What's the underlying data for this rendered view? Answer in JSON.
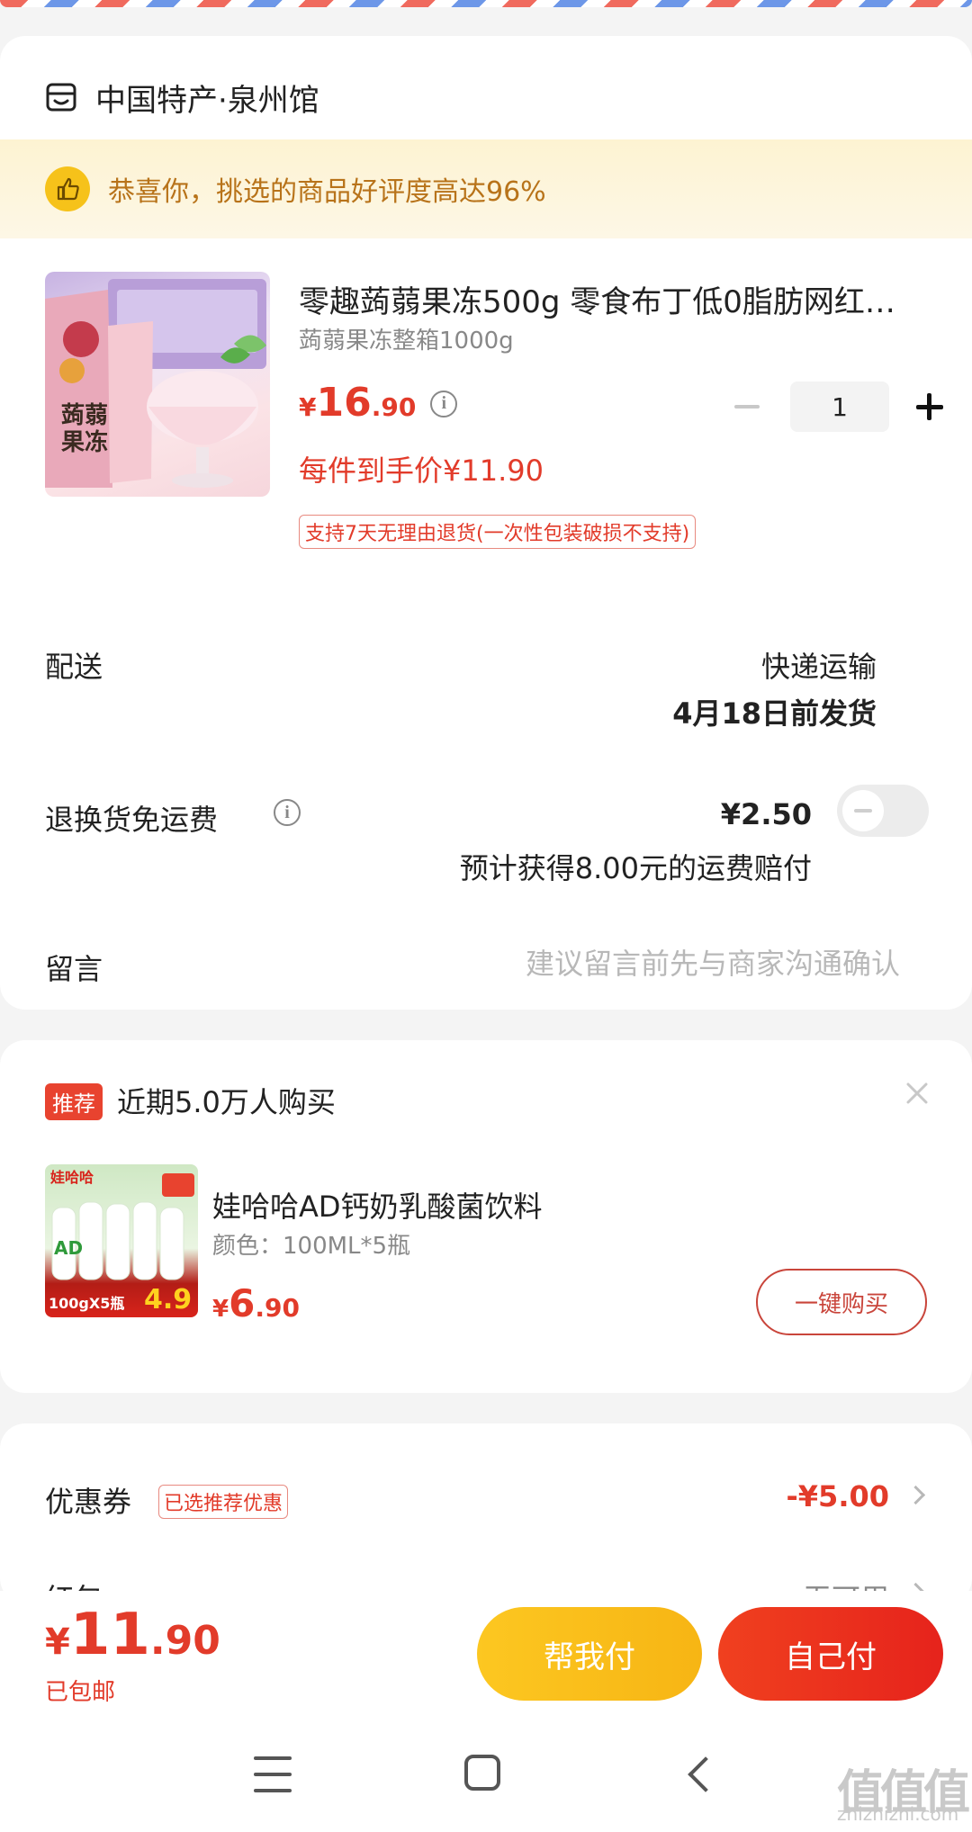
{
  "shop": {
    "name": "中国特产·泉州馆",
    "praise": "恭喜你，挑选的商品好评度高达96%"
  },
  "product": {
    "title": "零趣蒟蒻果冻500g 零食布丁低0脂肪网红…",
    "sku": "蒟蒻果冻整箱1000g",
    "price_symbol": "¥",
    "price_int": "16",
    "price_dec": ".90",
    "net_price": "每件到手价¥11.90",
    "return_policy": "支持7天无理由退货(一次性包装破损不支持)",
    "quantity": "1",
    "image_text_1": "蒟蒻",
    "image_text_2": "果冻"
  },
  "delivery": {
    "label": "配送",
    "method": "快递运输",
    "date": "4月18日前发货"
  },
  "return_fee": {
    "label": "退换货免运费",
    "amount": "¥2.50",
    "note": "预计获得8.00元的运费赔付",
    "enabled": false
  },
  "message": {
    "label": "留言",
    "placeholder": "建议留言前先与商家沟通确认"
  },
  "recommend": {
    "tag": "推荐",
    "title": "近期5.0万人购买",
    "product_name": "娃哈哈AD钙奶乳酸菌饮料",
    "spec": "颜色：100ML*5瓶",
    "price_symbol": "¥",
    "price_int": "6",
    "price_dec": ".90",
    "buy_label": "一键购买",
    "img_brand": "娃哈哈",
    "img_tag": "100gX5瓶",
    "img_price": "4.9",
    "img_ad": "AD"
  },
  "coupon": {
    "label": "优惠券",
    "tag": "已选推荐优惠",
    "amount": "-¥5.00"
  },
  "red_packet": {
    "label": "红包",
    "value": "无可用"
  },
  "footer": {
    "total_symbol": "¥",
    "total_int": "11",
    "total_dec": ".90",
    "shipping_note": "已包邮",
    "help_pay": "帮我付",
    "self_pay": "自己付"
  },
  "watermark": {
    "logo": "值值值",
    "url": "zhizhizhi.com"
  },
  "colors": {
    "accent_red": "#e23b2a",
    "help_button": "#fcc721",
    "self_button": "#e6231c",
    "praise_text": "#b8731a"
  }
}
